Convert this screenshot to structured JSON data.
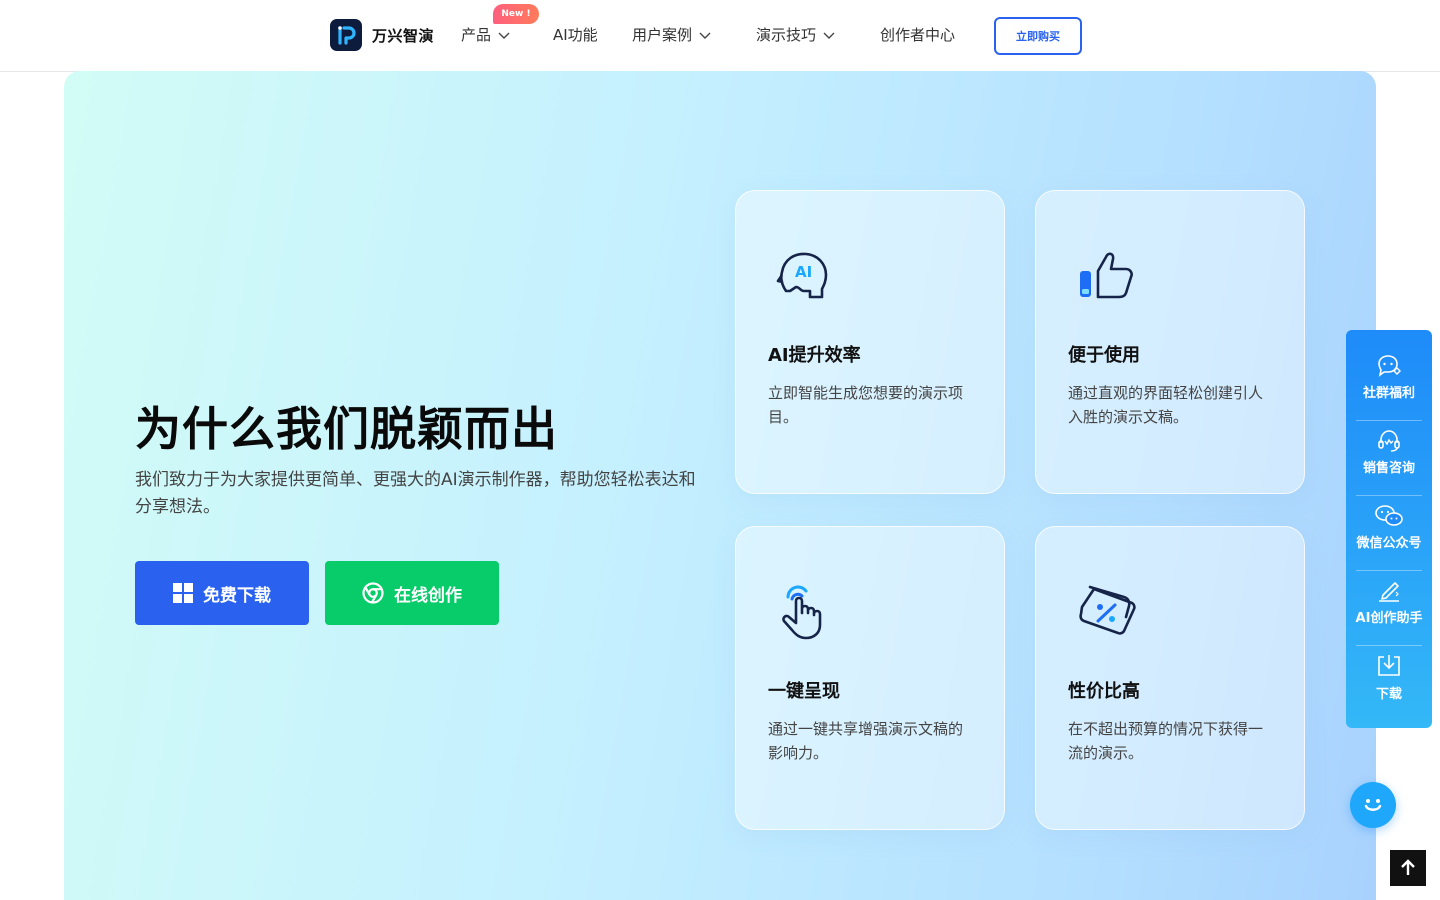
{
  "nav": {
    "logo_text": "万兴智演",
    "items": [
      {
        "label": "产品"
      },
      {
        "label": "AI功能"
      },
      {
        "label": "用户案例"
      },
      {
        "label": "演示技巧"
      },
      {
        "label": "创作者中心"
      }
    ],
    "badge": "New !",
    "buy_label": "立即购买"
  },
  "hero": {
    "title": "为什么我们脱颖而出",
    "subtitle": "我们致力于为大家提供更简单、更强大的AI演示制作器，帮助您轻松表达和分享想法。",
    "download_label": "免费下载",
    "online_label": "在线创作"
  },
  "cards": [
    {
      "icon": "ai-head-icon",
      "title": "AI提升效率",
      "desc": "立即智能生成您想要的演示项目。"
    },
    {
      "icon": "thumbs-up-icon",
      "title": "便于使用",
      "desc": "通过直观的界面轻松创建引人入胜的演示文稿。"
    },
    {
      "icon": "tap-hand-icon",
      "title": "一键呈现",
      "desc": "通过一键共享增强演示文稿的影响力。"
    },
    {
      "icon": "discount-tag-icon",
      "title": "性价比高",
      "desc": "在不超出预算的情况下获得一流的演示。"
    }
  ],
  "side": {
    "items": [
      {
        "icon": "community-icon",
        "label": "社群福利"
      },
      {
        "icon": "headset-icon",
        "label": "销售咨询"
      },
      {
        "icon": "wechat-icon",
        "label": "微信公众号"
      },
      {
        "icon": "pen-icon",
        "label": "AI创作助手"
      },
      {
        "icon": "download-icon",
        "label": "下载"
      }
    ]
  },
  "colors": {
    "primary": "#2a62ef",
    "green": "#08cb6a",
    "side_top": "#1e8bf9",
    "side_bottom": "#34b8f7"
  }
}
